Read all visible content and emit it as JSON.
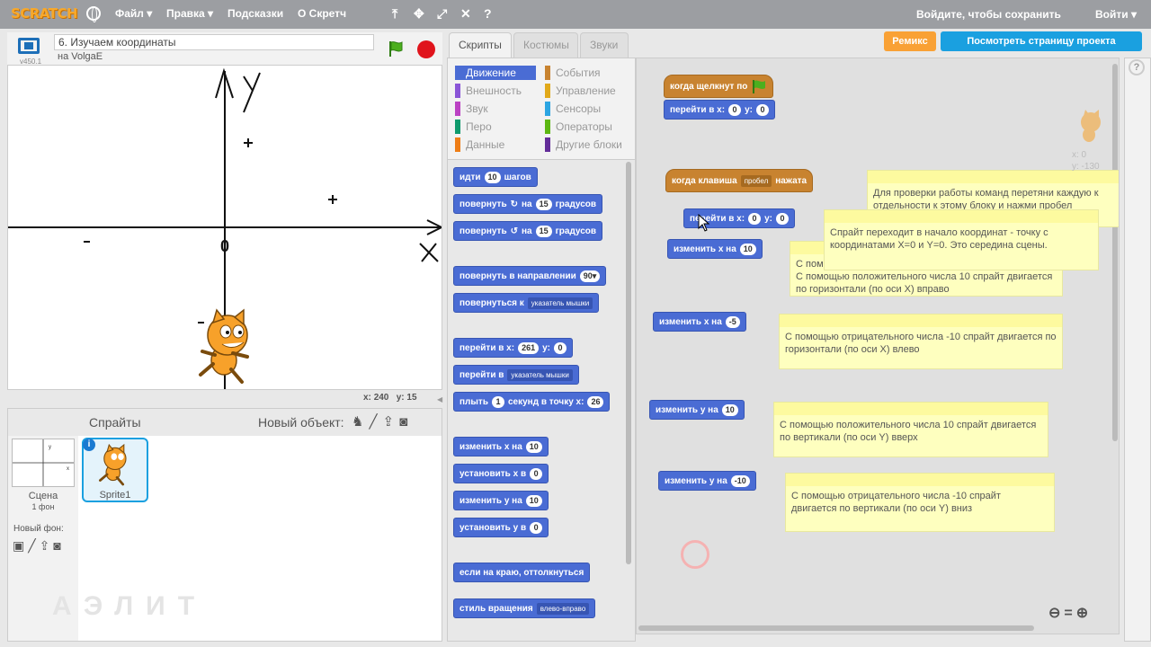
{
  "topbar": {
    "logo": "SCRATCH",
    "menus": [
      "Файл ▾",
      "Правка ▾",
      "Подсказки",
      "О Скретч"
    ],
    "login_prompt": "Войдите, чтобы сохранить",
    "login": "Войти ▾"
  },
  "stage": {
    "version": "v450.1",
    "project_title": "6. Изучаем координаты",
    "author": "на VolgaE",
    "axis_x": "X",
    "axis_y": "Y",
    "origin": "0",
    "mouse_x_label": "x:",
    "mouse_x": "240",
    "mouse_y_label": "y:",
    "mouse_y": "15"
  },
  "sprites": {
    "title": "Спрайты",
    "new_object": "Новый объект:",
    "scene_label": "Сцена",
    "scene_sub": "1 фон",
    "new_bg": "Новый фон:",
    "sprite1": "Sprite1",
    "watermark": "АЭЛИТ"
  },
  "tabs": [
    "Скрипты",
    "Костюмы",
    "Звуки"
  ],
  "categories": [
    {
      "label": "Движение",
      "color": "#4a6cd4"
    },
    {
      "label": "Внешность",
      "color": "#8a55d7"
    },
    {
      "label": "Звук",
      "color": "#bb42c3"
    },
    {
      "label": "Перо",
      "color": "#0e9a6c"
    },
    {
      "label": "Данные",
      "color": "#ee7d16"
    },
    {
      "label": "События",
      "color": "#c88330"
    },
    {
      "label": "Управление",
      "color": "#e1a91a"
    },
    {
      "label": "Сенсоры",
      "color": "#2ca5e2"
    },
    {
      "label": "Операторы",
      "color": "#5cb712"
    },
    {
      "label": "Другие блоки",
      "color": "#632d99"
    }
  ],
  "palette_blocks": {
    "move": {
      "a": "идти",
      "v": "10",
      "b": "шагов"
    },
    "turn_right": {
      "a": "повернуть",
      "v": "15",
      "b": "градусов",
      "b_pre": "на"
    },
    "turn_left": {
      "a": "повернуть",
      "v": "15",
      "b": "градусов",
      "b_pre": "на"
    },
    "point_dir": {
      "a": "повернуть в направлении",
      "v": "90▾"
    },
    "point_towards": {
      "a": "повернуться к",
      "dd": "указатель мышки"
    },
    "goto_xy": {
      "a": "перейти в x:",
      "x": "261",
      "yl": "y:",
      "y": "0"
    },
    "goto": {
      "a": "перейти в",
      "dd": "указатель мышки"
    },
    "glide": {
      "a": "плыть",
      "v": "1",
      "b": "секунд в точку x:",
      "x": "26"
    },
    "change_x": {
      "a": "изменить х на",
      "v": "10"
    },
    "set_x": {
      "a": "установить х в",
      "v": "0"
    },
    "change_y": {
      "a": "изменить у на",
      "v": "10"
    },
    "set_y": {
      "a": "установить у в",
      "v": "0"
    },
    "bounce": {
      "a": "если на краю, оттолкнуться"
    },
    "rotation_style": {
      "a": "стиль вращения",
      "dd": "влево-вправо"
    }
  },
  "top_buttons": {
    "remix": "Ремикс",
    "see_page": "Посмотреть страницу проекта"
  },
  "scripts": {
    "when_flag": "когда щелкнут по",
    "goto1": {
      "a": "перейти в x:",
      "x": "0",
      "yl": "y:",
      "y": "0"
    },
    "when_key": {
      "a": "когда клавиша",
      "dd": "пробел",
      "b": "нажата"
    },
    "goto2": {
      "a": "перейти в x:",
      "x": "0",
      "yl": "y:",
      "y": "0"
    },
    "change_x1": {
      "a": "изменить х на",
      "v": "10"
    },
    "change_x2": {
      "a": "изменить х на",
      "v": "-5"
    },
    "change_y1": {
      "a": "изменить у на",
      "v": "10"
    },
    "change_y2": {
      "a": "изменить у на",
      "v": "-10"
    }
  },
  "notes": {
    "n1": "Для проверки работы команд перетяни каждую к отдельности к этому блоку и нажми пробел",
    "n2": "Спрайт переходит в начало координат - точку с координатами X=0 и Y=0. Это середина сцены.",
    "n3": "С помощью положительного числа 10 спрайт двигается по горизонтали (по оси Х) вправо",
    "n3_head": "С пом",
    "n4": "С помощью отрицательного числа -10 спрайт двигается по горизонтали (по оси Х) влево",
    "n5": "С помощью положительного числа 10 спрайт двигается по вертикали (по оси Y) вверх",
    "n6": "С помощью отрицательного числа -10 спрайт двигается по вертикали (по оси Y) вниз"
  },
  "sprite_info": {
    "x": "x: 0",
    "y": "y: -130"
  }
}
